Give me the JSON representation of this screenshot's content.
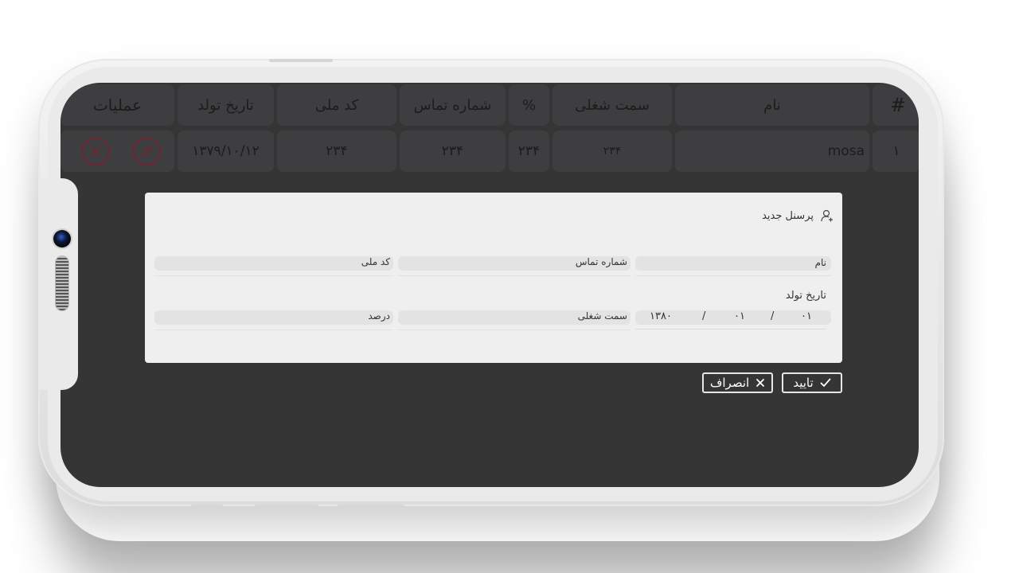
{
  "table": {
    "headers": {
      "index": "#",
      "name": "نام",
      "position": "سمت شغلی",
      "percent": "%",
      "phone": "شماره تماس",
      "national_code": "کد ملی",
      "birth_date": "تاریخ تولد",
      "actions": "عملیات"
    },
    "rows": [
      {
        "index": "۱",
        "name": "mosa",
        "position": "۲۳۴",
        "percent": "۲۳۴",
        "phone": "۲۳۴",
        "national_code": "۲۳۴",
        "birth_date": "۱۳۷۹/۱۰/۱۲",
        "edit_icon": "pencil-icon",
        "delete_icon": "close-icon"
      }
    ]
  },
  "modal": {
    "title": "پرسنل جدید",
    "title_icon": "user-plus-icon",
    "fields": {
      "name_label": "نام",
      "phone_label": "شماره تماس",
      "national_code_label": "کد ملی",
      "birth_date_label": "تاریخ تولد",
      "position_label": "سمت شغلی",
      "percent_label": "درصد"
    },
    "birth_date": {
      "day": "۰۱",
      "month": "۰۱",
      "year": "۱۳۸۰",
      "separator": "/"
    }
  },
  "buttons": {
    "confirm_label": "تایید",
    "confirm_icon": "check-icon",
    "cancel_label": "انصراف",
    "cancel_icon": "close-icon"
  },
  "colors": {
    "screen_bg": "#353536",
    "cell_bg": "#3e3e40",
    "action_border": "#6e2530",
    "modal_bg": "#efefef"
  }
}
